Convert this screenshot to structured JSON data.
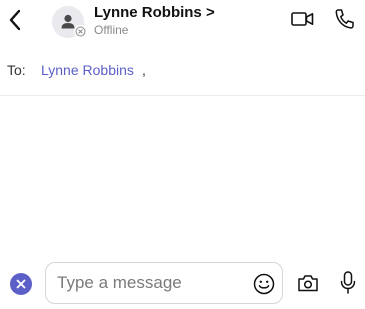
{
  "header": {
    "back_icon": "chevron-left-icon",
    "contact_name": "Lynne Robbins >",
    "contact_status": "Offline",
    "avatar_icon": "person-icon",
    "presence_icon": "offline-x-icon",
    "video_icon": "video-camera-icon",
    "phone_icon": "phone-icon"
  },
  "recipients": {
    "label": "To:",
    "names": [
      "Lynne Robbins"
    ],
    "separator": ","
  },
  "composer": {
    "dismiss_icon": "close-icon",
    "placeholder": "Type a message",
    "value": "",
    "emoji_icon": "smiley-icon",
    "camera_icon": "camera-icon",
    "mic_icon": "microphone-icon"
  },
  "colors": {
    "accent": "#5b5fc7",
    "text": "#111111",
    "muted": "#8a8a8a",
    "divider": "#ececec"
  }
}
